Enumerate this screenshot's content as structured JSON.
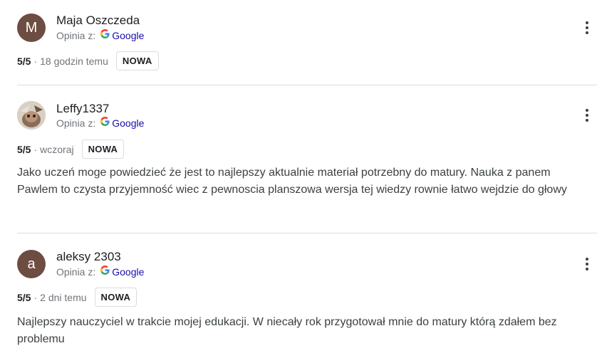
{
  "reviews": [
    {
      "initial": "M",
      "avatar_color": "#6d4c41",
      "name": "Maja Oszczeda",
      "source_label": "Opinia z:",
      "source_name": "Google",
      "rating": "5/5",
      "time": "18 godzin temu",
      "badge": "NOWA",
      "text": ""
    },
    {
      "initial": "",
      "avatar_color": "#c8b7a6",
      "name": "Leffy1337",
      "source_label": "Opinia z:",
      "source_name": "Google",
      "rating": "5/5",
      "time": "wczoraj",
      "badge": "NOWA",
      "text": "Jako uczeń moge powiedzieć że jest to najlepszy aktualnie materiał potrzebny do matury. Nauka z panem Pawlem to czysta przyjemność wiec z pewnoscia planszowa wersja tej wiedzy rownie łatwo wejdzie do głowy"
    },
    {
      "initial": "a",
      "avatar_color": "#6d4c41",
      "name": "aleksy 2303",
      "source_label": "Opinia z:",
      "source_name": "Google",
      "rating": "5/5",
      "time": "2 dni temu",
      "badge": "NOWA",
      "text": "Najlepszy nauczyciel w trakcie mojej edukacji. W niecały rok przygotował mnie do matury którą zdałem bez problemu"
    }
  ],
  "google_logo_letter": "G",
  "icons": {
    "more": "more-vert-icon",
    "google": "google-g-icon"
  }
}
